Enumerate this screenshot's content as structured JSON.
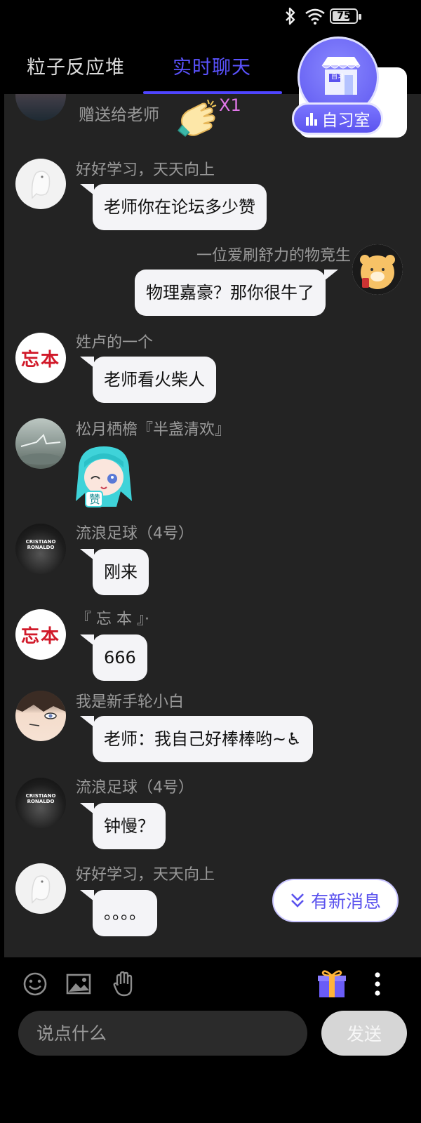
{
  "status_bar": {
    "battery": "75",
    "battery_level": 0.75
  },
  "tabs": [
    {
      "label": "粒子反应堆",
      "active": false
    },
    {
      "label": "实时聊天",
      "active": true
    },
    {
      "label": "",
      "active": false
    }
  ],
  "study_room": {
    "label": "自习室",
    "shop_sign": "自习"
  },
  "gift_event": {
    "text": "赠送给老师",
    "count": "X1"
  },
  "messages": [
    {
      "user": "好好学习，天天向上",
      "text": "老师你在论坛多少赞"
    },
    {
      "user": "一位爱刷舒力的物竞生",
      "text": "物理嘉豪？那你很牛了"
    },
    {
      "user": "姓卢的一个",
      "text": "老师看火柴人"
    },
    {
      "user": "松月栖檐『半盏清欢』",
      "sticker_text": "赞"
    },
    {
      "user": "流浪足球（4号）",
      "text": "刚来"
    },
    {
      "user": "『 忘 本 』·",
      "text": "666"
    },
    {
      "user": "我是新手轮小白",
      "text": "老师：我自己好棒棒哟~♿"
    },
    {
      "user": "流浪足球（4号）",
      "text": "钟慢？"
    },
    {
      "user": "好好学习，天天向上",
      "text": "。。。。"
    }
  ],
  "avatar_text": {
    "red_seal": "忘本",
    "player": "CRISTIANO RONALDO"
  },
  "new_messages_button": "有新消息",
  "input": {
    "placeholder": "说点什么",
    "value": ""
  },
  "send_button": "发送",
  "colors": {
    "accent": "#5b53ff",
    "chat_bg": "#232323",
    "bubble": "#f4f4f7"
  }
}
